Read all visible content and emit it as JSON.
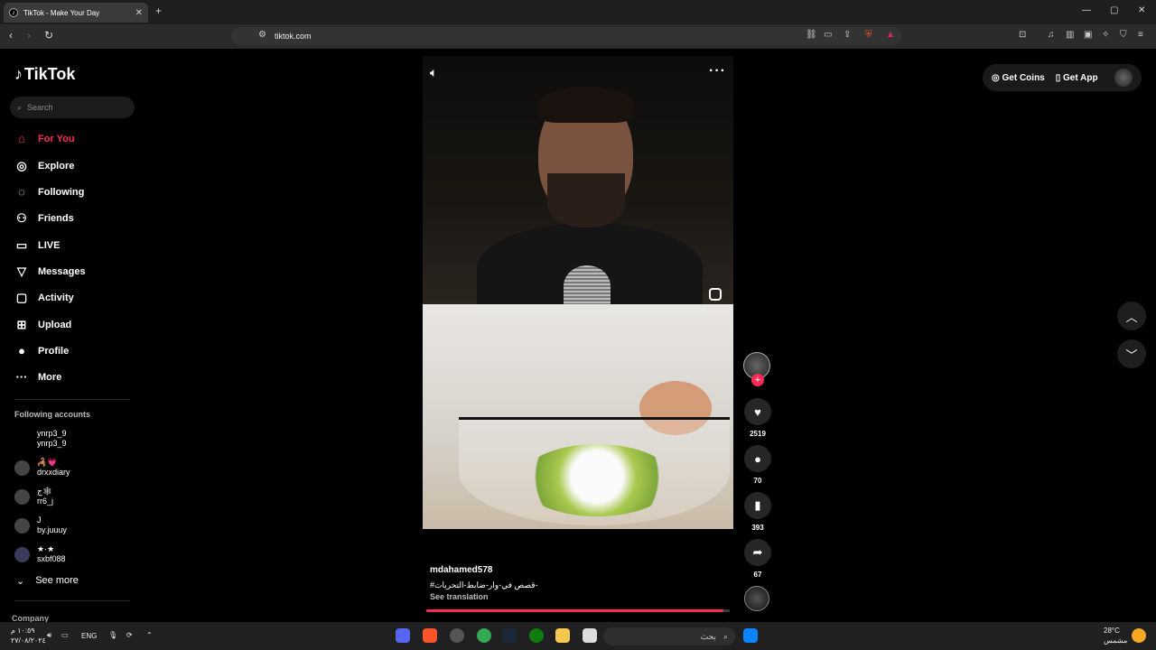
{
  "browser": {
    "tab_title": "TikTok - Make Your Day",
    "tab_close": "✕",
    "new_tab": "+",
    "url": "tiktok.com",
    "win_min": "—",
    "win_max": "▢",
    "win_close": "✕"
  },
  "sidebar": {
    "logo": "TikTok",
    "search_placeholder": "Search",
    "nav": [
      {
        "label": "For You",
        "icon": "home-icon",
        "active": true
      },
      {
        "label": "Explore",
        "icon": "compass-icon"
      },
      {
        "label": "Following",
        "icon": "following-icon"
      },
      {
        "label": "Friends",
        "icon": "friends-icon"
      },
      {
        "label": "LIVE",
        "icon": "live-icon"
      },
      {
        "label": "Messages",
        "icon": "messages-icon"
      },
      {
        "label": "Activity",
        "icon": "activity-icon"
      },
      {
        "label": "Upload",
        "icon": "upload-icon"
      },
      {
        "label": "Profile",
        "icon": "profile-icon"
      },
      {
        "label": "More",
        "icon": "more-icon"
      }
    ],
    "following_title": "Following accounts",
    "accounts": [
      {
        "name": "ynrp3_9",
        "handle": "ynrp3_9"
      },
      {
        "name": "🦂💗",
        "handle": "drxxdiary"
      },
      {
        "name": "ج🕸",
        "handle": "rr6_j"
      },
      {
        "name": "J",
        "handle": "by.juuuy"
      },
      {
        "name": "★·★",
        "handle": "sxbf088"
      }
    ],
    "see_more": "See more",
    "company": "Company"
  },
  "video": {
    "username": "mdahamed578",
    "caption": "#قصص في-وار-ضابط-التحريات-",
    "see_translation": "See translation",
    "progress": 0.98
  },
  "actions": {
    "likes": "2519",
    "comments": "70",
    "saves": "393",
    "shares": "67",
    "follow": "+"
  },
  "header": {
    "get_coins": "Get Coins",
    "get_app": "Get App"
  },
  "taskbar": {
    "lang": "ENG",
    "time": "١٠:٥٩ م",
    "date": "٢٧/٠٨/٢٠٢٤",
    "weather": "28°C",
    "weather_desc": "مشمس",
    "search_text": "بحث"
  },
  "colors": {
    "accent": "#fe2c55",
    "background": "#000000"
  }
}
